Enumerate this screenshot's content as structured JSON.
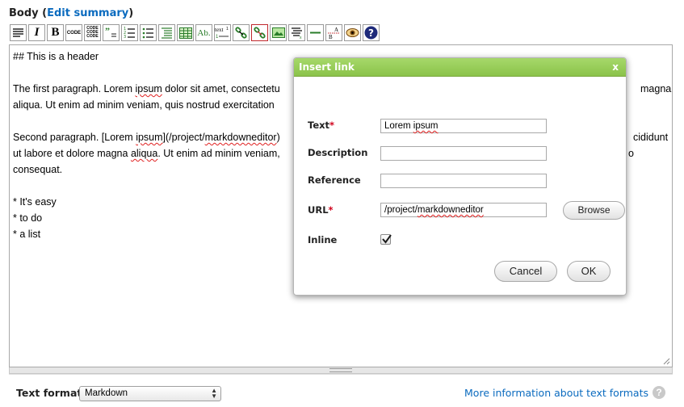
{
  "field": {
    "label": "Body",
    "open_paren": "(",
    "edit_summary": "Edit summary",
    "close_paren": ")"
  },
  "toolbar": {
    "buttons": [
      {
        "name": "normal-paragraph-icon"
      },
      {
        "name": "italic-icon",
        "text": "I"
      },
      {
        "name": "bold-icon",
        "text": "B"
      },
      {
        "name": "code-icon",
        "text": "CODE"
      },
      {
        "name": "code-block-icon",
        "text": "CODE"
      },
      {
        "name": "blockquote-icon",
        "text": "”"
      },
      {
        "name": "ordered-list-icon"
      },
      {
        "name": "unordered-list-icon"
      },
      {
        "name": "indent-icon"
      },
      {
        "name": "table-icon"
      },
      {
        "name": "abbreviation-icon",
        "text": "Ab."
      },
      {
        "name": "footnote-icon",
        "text": "text"
      },
      {
        "name": "link-icon"
      },
      {
        "name": "unlink-icon"
      },
      {
        "name": "image-icon"
      },
      {
        "name": "definition-list-icon"
      },
      {
        "name": "horizontal-rule-icon"
      },
      {
        "name": "line-break-icon",
        "text": "A"
      },
      {
        "name": "preview-icon"
      },
      {
        "name": "help-icon",
        "text": "?"
      }
    ]
  },
  "editor": {
    "line1": "## This is a header",
    "line3a": "The first paragraph. Lorem ",
    "line3b": "ipsum",
    "line3c": " dolor sit amet, consectetu",
    "line3right": "magna",
    "line4": "aliqua. Ut enim ad minim veniam, quis nostrud exercitation",
    "line6a": "Second paragraph. [Lorem ",
    "line6b": "ipsum",
    "line6c": "](/project/",
    "line6d": "markdowneditor",
    "line6e": ")",
    "line6right": "cididunt",
    "line7a": "ut labore et dolore magna ",
    "line7b": "aliqua",
    "line7c": ". Ut enim ad minim veniam,",
    "line7right": "o",
    "line8": "consequat.",
    "line10": "* It's easy",
    "line11": "* to do",
    "line12": "* a list"
  },
  "footer": {
    "text_format_label": "Text format",
    "text_format_value": "Markdown",
    "more_info_link": "More information about text formats",
    "help_symbol": "?"
  },
  "dialog": {
    "title": "Insert link",
    "close_symbol": "x",
    "fields": {
      "text_label": "Text",
      "text_value_a": "Lorem ",
      "text_value_b": "ipsum",
      "description_label": "Description",
      "description_value": "",
      "reference_label": "Reference",
      "reference_value": "",
      "url_label": "URL",
      "url_value_a": "/project/",
      "url_value_b": "markdowneditor",
      "inline_label": "Inline",
      "required_mark": "*"
    },
    "inline_checked": true,
    "browse_label": "Browse",
    "cancel_label": "Cancel",
    "ok_label": "OK"
  },
  "colors": {
    "link": "#0b6bbf",
    "dialog_title_bar": "#8bc34a",
    "required": "#d0021b",
    "active_button_border": "#c0282d"
  }
}
